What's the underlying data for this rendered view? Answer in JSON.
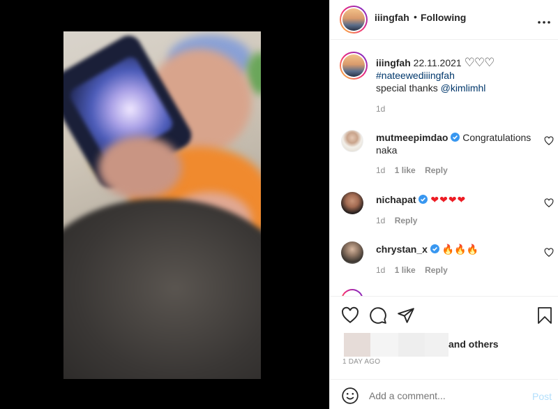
{
  "post_author": {
    "username": "iiingfah",
    "follow_separator": "•",
    "follow_status": "Following",
    "more_icon": "ellipsis-icon"
  },
  "caption": {
    "username": "iiingfah",
    "date": "22.11.2021",
    "hearts": "♡♡♡",
    "hashtag": "#nateewediiingfah",
    "text_prefix": "special thanks",
    "mention": "@kimlimhl",
    "time": "1d"
  },
  "comments": [
    {
      "username": "mutmeepimdao",
      "text": "Congratulations",
      "text2": "naka",
      "time": "1d",
      "likes": "1 like",
      "reply": "Reply"
    },
    {
      "username": "nichapat",
      "text": "❤❤❤❤",
      "time": "1d",
      "reply": "Reply"
    },
    {
      "username": "chrystan_x",
      "text": "🔥🔥🔥",
      "time": "1d",
      "likes": "1 like",
      "reply": "Reply"
    }
  ],
  "actions": {
    "like_icon": "heart-icon",
    "comment_icon": "comment-bubble-icon",
    "share_icon": "paper-plane-icon",
    "save_icon": "bookmark-icon",
    "and_others": "and others",
    "posted_ago": "1 DAY AGO"
  },
  "composer": {
    "emoji_icon": "smiley-icon",
    "placeholder": "Add a comment...",
    "post_label": "Post"
  },
  "colors": {
    "link": "#00376b",
    "verified": "#3897f0",
    "post_disabled": "#b2dffc",
    "heart_red": "#ed1c24"
  }
}
